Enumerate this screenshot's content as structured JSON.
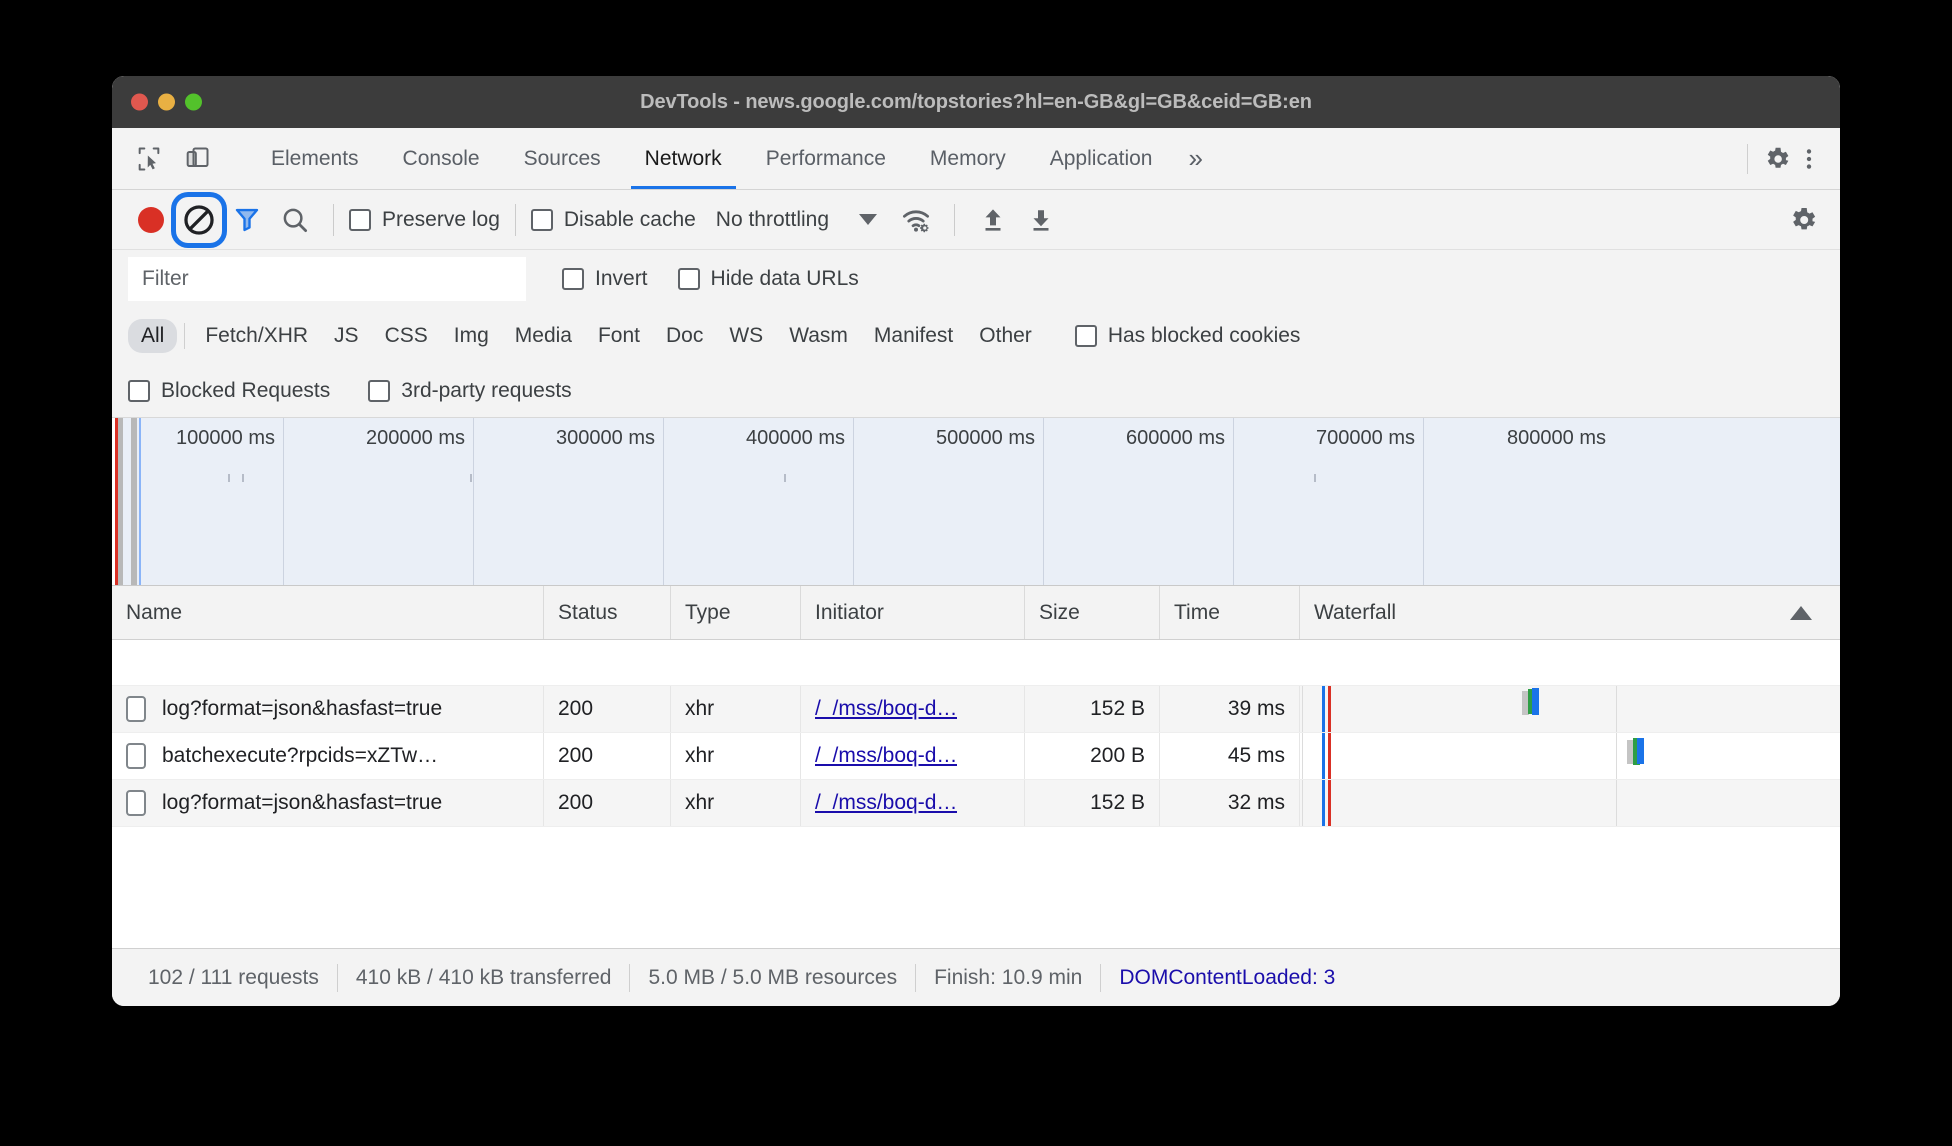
{
  "window": {
    "title": "DevTools - news.google.com/topstories?hl=en-GB&gl=GB&ceid=GB:en"
  },
  "panel_tabs": {
    "items": [
      {
        "label": "Elements",
        "active": false
      },
      {
        "label": "Console",
        "active": false
      },
      {
        "label": "Sources",
        "active": false
      },
      {
        "label": "Network",
        "active": true
      },
      {
        "label": "Performance",
        "active": false
      },
      {
        "label": "Memory",
        "active": false
      },
      {
        "label": "Application",
        "active": false
      }
    ],
    "more_label": "»",
    "inspect_icon": "inspect-element-icon",
    "device_icon": "device-toolbar-icon",
    "settings_icon": "gear-icon",
    "menu_icon": "more-vertical-icon"
  },
  "network_toolbar": {
    "record_icon": "record-icon",
    "clear_icon": "clear-icon",
    "filter_icon": "funnel-icon",
    "search_icon": "search-icon",
    "preserve_log_label": "Preserve log",
    "preserve_log_checked": false,
    "disable_cache_label": "Disable cache",
    "disable_cache_checked": false,
    "throttling_value": "No throttling",
    "wifi_icon": "wifi-settings-icon",
    "upload_icon": "upload-icon",
    "download_icon": "download-icon",
    "settings_icon": "gear-icon"
  },
  "filter_row": {
    "filter_placeholder": "Filter",
    "filter_value": "",
    "invert_label": "Invert",
    "invert_checked": false,
    "hide_data_urls_label": "Hide data URLs",
    "hide_data_urls_checked": false
  },
  "type_chips": {
    "items": [
      {
        "label": "All",
        "active": true
      },
      {
        "label": "Fetch/XHR",
        "active": false
      },
      {
        "label": "JS",
        "active": false
      },
      {
        "label": "CSS",
        "active": false
      },
      {
        "label": "Img",
        "active": false
      },
      {
        "label": "Media",
        "active": false
      },
      {
        "label": "Font",
        "active": false
      },
      {
        "label": "Doc",
        "active": false
      },
      {
        "label": "WS",
        "active": false
      },
      {
        "label": "Wasm",
        "active": false
      },
      {
        "label": "Manifest",
        "active": false
      },
      {
        "label": "Other",
        "active": false
      }
    ],
    "has_blocked_cookies_label": "Has blocked cookies",
    "has_blocked_cookies_checked": false
  },
  "blocked_row": {
    "blocked_requests_label": "Blocked Requests",
    "blocked_requests_checked": false,
    "third_party_label": "3rd-party requests",
    "third_party_checked": false
  },
  "overview": {
    "ticks": [
      "100000 ms",
      "200000 ms",
      "300000 ms",
      "400000 ms",
      "500000 ms",
      "600000 ms",
      "700000 ms",
      "800000 ms"
    ]
  },
  "table": {
    "columns": [
      "Name",
      "Status",
      "Type",
      "Initiator",
      "Size",
      "Time",
      "Waterfall"
    ],
    "rows": [
      {
        "name": "log?format=json&hasfast=true",
        "status": "200",
        "type": "xhr",
        "initiator": "/_/mss/boq-d…",
        "size": "152 B",
        "time": "39 ms"
      },
      {
        "name": "batchexecute?rpcids=xZTw…",
        "status": "200",
        "type": "xhr",
        "initiator": "/_/mss/boq-d…",
        "size": "200 B",
        "time": "45 ms"
      },
      {
        "name": "log?format=json&hasfast=true",
        "status": "200",
        "type": "xhr",
        "initiator": "/_/mss/boq-d…",
        "size": "152 B",
        "time": "32 ms"
      }
    ]
  },
  "status_bar": {
    "requests": "102 / 111 requests",
    "transferred": "410 kB / 410 kB transferred",
    "resources": "5.0 MB / 5.0 MB resources",
    "finish": "Finish: 10.9 min",
    "domcontentloaded": "DOMContentLoaded: 3"
  },
  "colors": {
    "accent_blue": "#1a73e8",
    "record_red": "#d93025",
    "link_blue": "#1a0dab",
    "titlebar": "#3c3c3c",
    "toolbar_bg": "#f3f3f3",
    "overview_bg": "#eaeff7"
  }
}
